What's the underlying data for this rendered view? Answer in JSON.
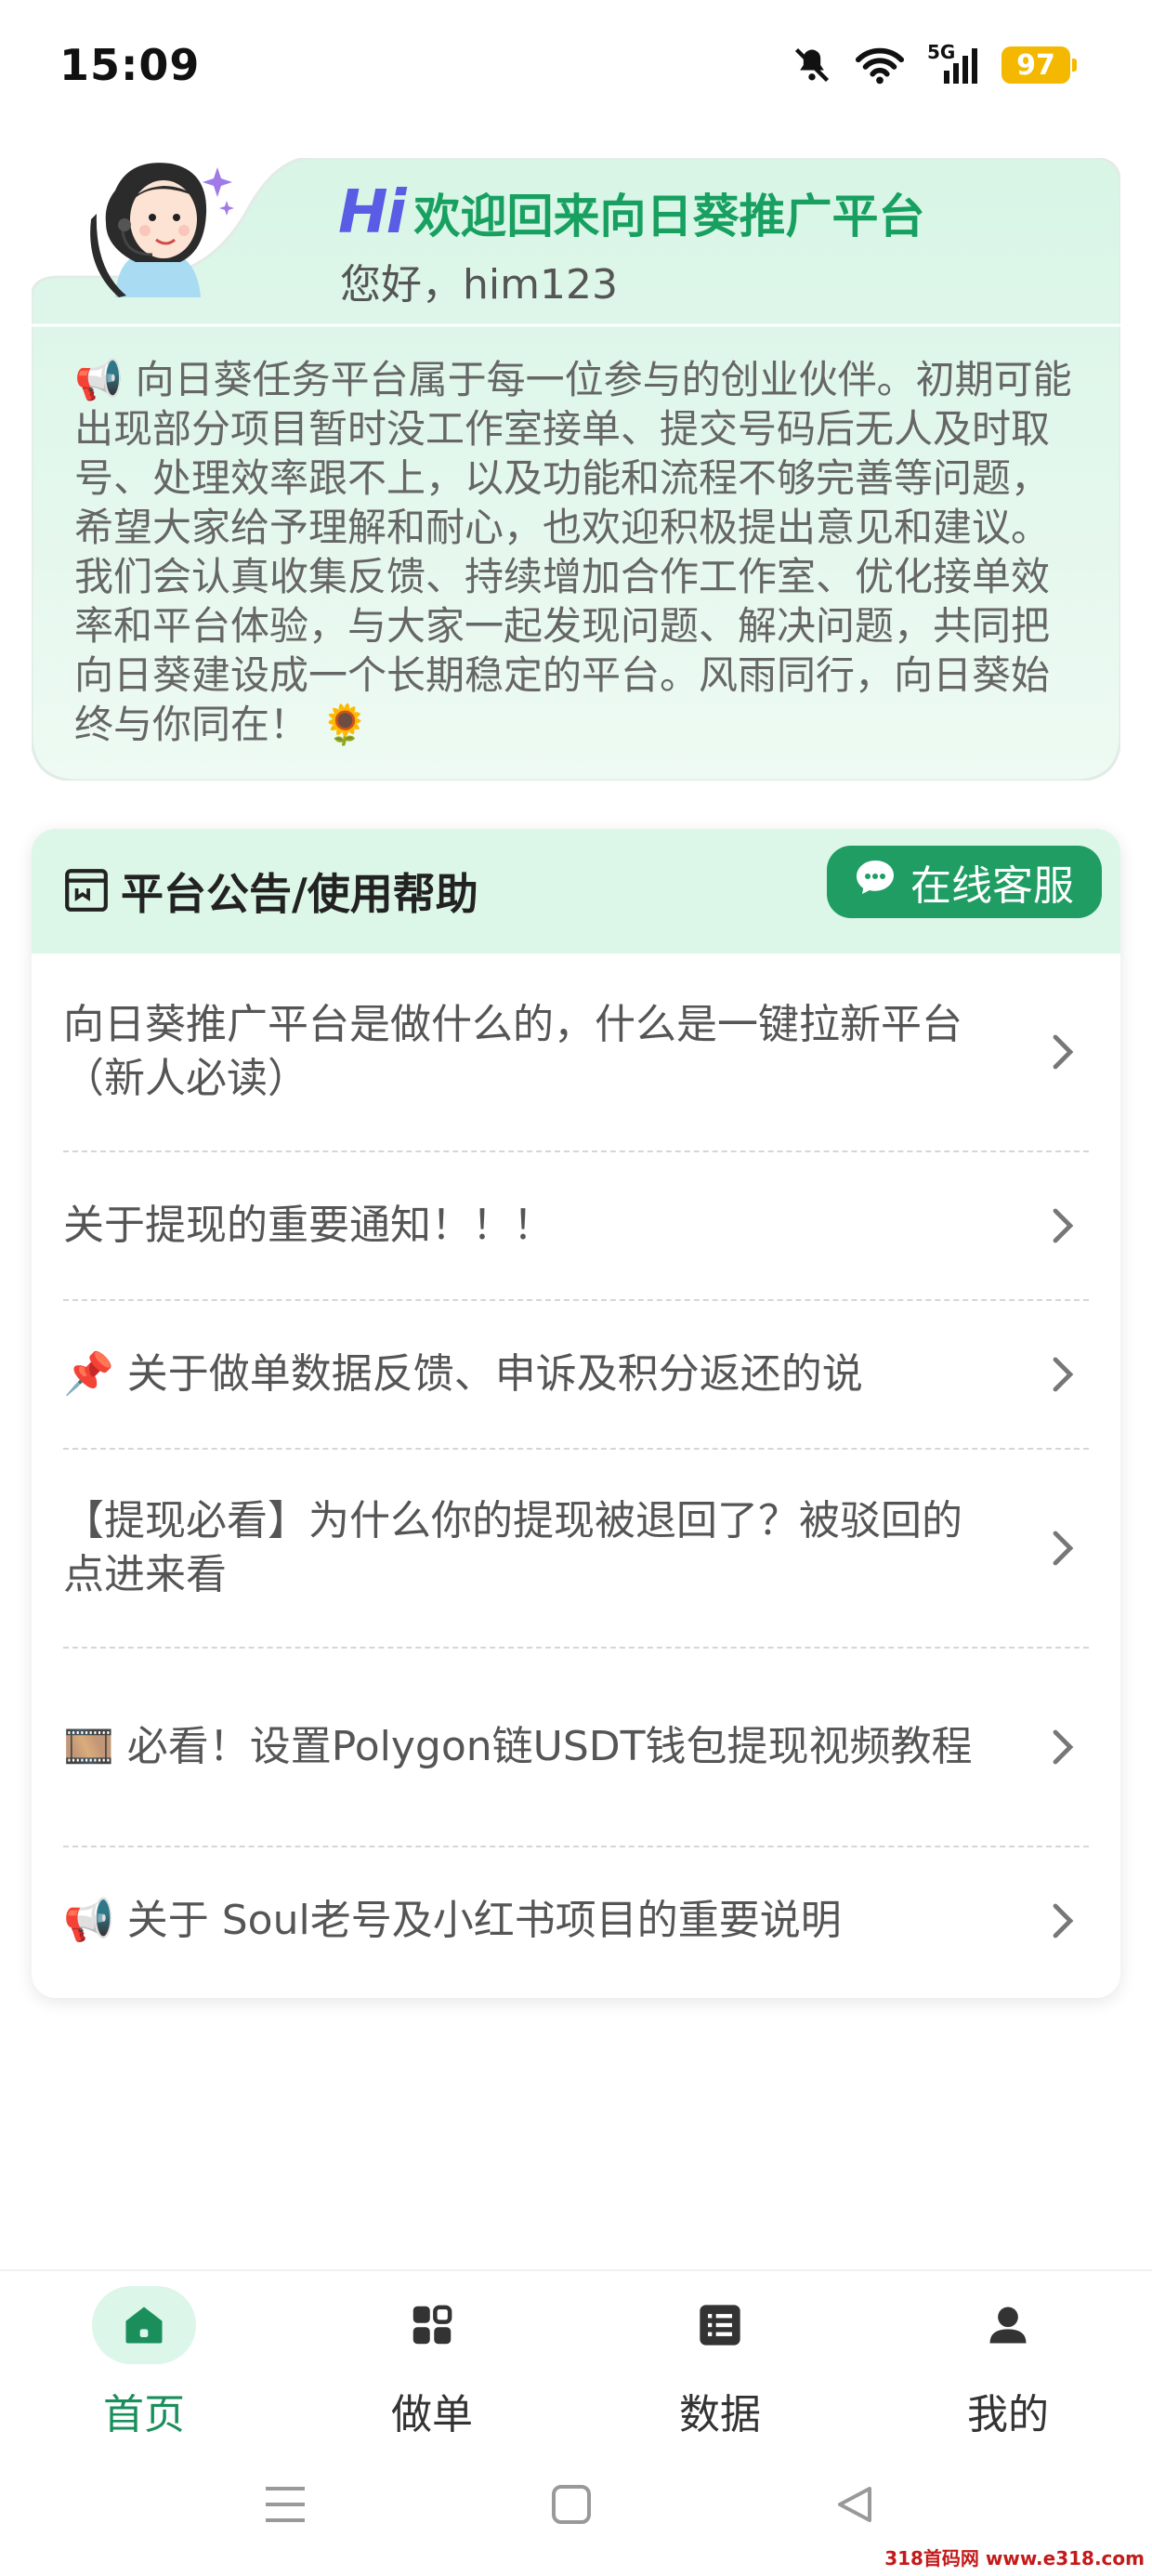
{
  "status_bar": {
    "time": "15:09",
    "network": "5G",
    "battery": "97",
    "battery_color": "#f5b800"
  },
  "welcome": {
    "hi": "Hi",
    "title": "欢迎回来向日葵推广平台",
    "greeting": "您好，him123",
    "notice": "📢 向日葵任务平台属于每一位参与的创业伙伴。初期可能出现部分项目暂时没工作室接单、提交号码后无人及时取号、处理效率跟不上，以及功能和流程不够完善等问题，希望大家给予理解和耐心，也欢迎积极提出意见和建议。我们会认真收集反馈、持续增加合作工作室、优化接单效率和平台体验，与大家一起发现问题、解决问题，共同把向日葵建设成一个长期稳定的平台。风雨同行，向日葵始终与你同在！ 🌻"
  },
  "announcements": {
    "header_title": "平台公告/使用帮助",
    "service_button": "在线客服",
    "items": [
      {
        "label": "向日葵推广平台是做什么的，什么是一键拉新平台（新人必读）"
      },
      {
        "label": "关于提现的重要通知！！！"
      },
      {
        "label": "📌 关于做单数据反馈、申诉及积分返还的说"
      },
      {
        "label": "【提现必看】为什么你的提现被退回了？被驳回的点进来看"
      },
      {
        "label": "🎞️ 必看！设置Polygon链USDT钱包提现视频教程"
      },
      {
        "label": "📢 关于 Soul老号及小红书项目的重要说明"
      }
    ]
  },
  "bottom_nav": {
    "items": [
      {
        "label": "首页",
        "icon": "home-icon",
        "active": true
      },
      {
        "label": "做单",
        "icon": "grid-icon",
        "active": false
      },
      {
        "label": "数据",
        "icon": "list-icon",
        "active": false
      },
      {
        "label": "我的",
        "icon": "user-icon",
        "active": false
      }
    ]
  },
  "watermark": "318首码网 www.e318.com",
  "colors": {
    "accent": "#1f9d63",
    "header_bg": "#dcf6e8",
    "welcome_bg": "#e6f8ef"
  }
}
